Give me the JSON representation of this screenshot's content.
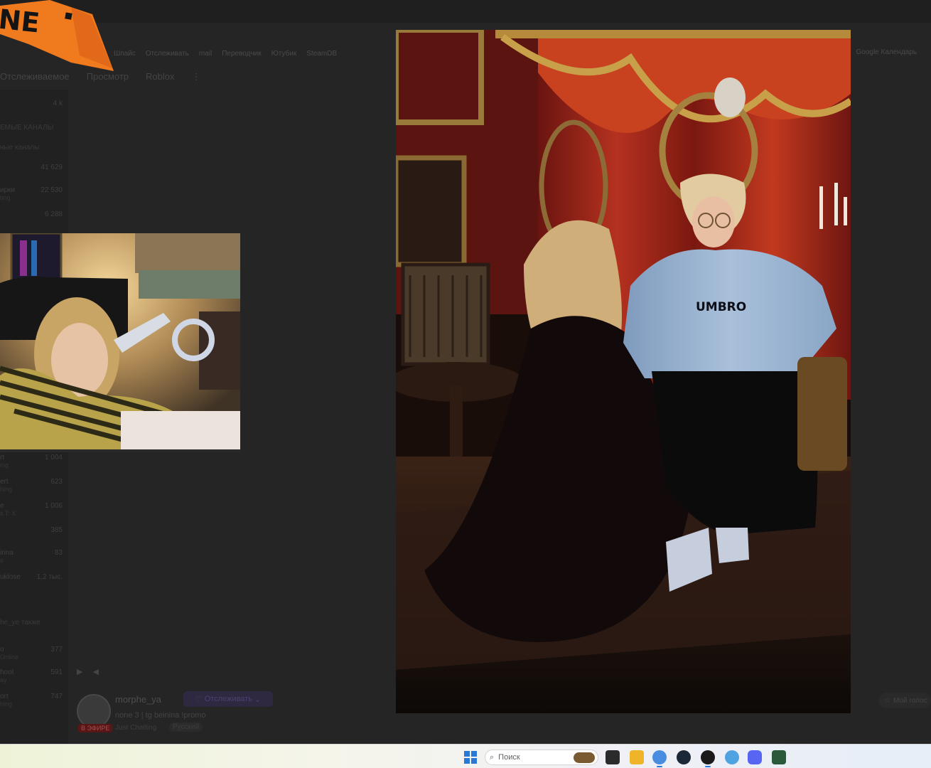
{
  "bookmarks": [
    "Шпайс",
    "Отслеживать",
    "mail",
    "Переводчик",
    "Ютубик",
    "SteamDB"
  ],
  "bookmarks_right": "Google Календарь",
  "tabs": [
    "Отслеживаемое",
    "Просмотр",
    "Roblox",
    "⋮"
  ],
  "sidebar": {
    "head_count": "4 k",
    "section1": "ЕМЫЕ КАНАЛЫ",
    "section2": "ные каналы",
    "rows": [
      {
        "label": "",
        "count": "41 629",
        "sub": ""
      },
      {
        "label": "ирки",
        "count": "22 530",
        "sub": "ting"
      },
      {
        "label": "",
        "count": "6 288",
        "sub": ""
      },
      {
        "label": "rt",
        "count": "1 004",
        "sub": "ing"
      },
      {
        "label": "ert",
        "count": "623",
        "sub": "hing"
      },
      {
        "label": "e",
        "count": "1 006",
        "sub": "s T: X"
      },
      {
        "label": "",
        "count": "385",
        "sub": ""
      },
      {
        "label": "inna",
        "count": "83",
        "sub": "s"
      },
      {
        "label": "uklose",
        "count": "1,2 тыс.",
        "sub": ""
      }
    ],
    "section3": "he_ye также",
    "rows2": [
      {
        "label": "o",
        "count": "377",
        "sub": "Online"
      },
      {
        "label": "hoot",
        "count": "591",
        "sub": "ay"
      },
      {
        "label": "ort",
        "count": "747",
        "sub": "hing"
      }
    ]
  },
  "channel": {
    "name": "morphe_ya",
    "follow_label": "Отслеживать",
    "title": "none 3 | tg beinina !promo",
    "category": "Just Chatting",
    "tag": "Русский",
    "live_badge": "В ЭФИРЕ"
  },
  "right_button": "Мой голос",
  "taskbar": {
    "search_placeholder": "Поиск"
  },
  "colors": {
    "logo_orange": "#f07a1e",
    "taskbar_accent": "#2a78d6"
  }
}
